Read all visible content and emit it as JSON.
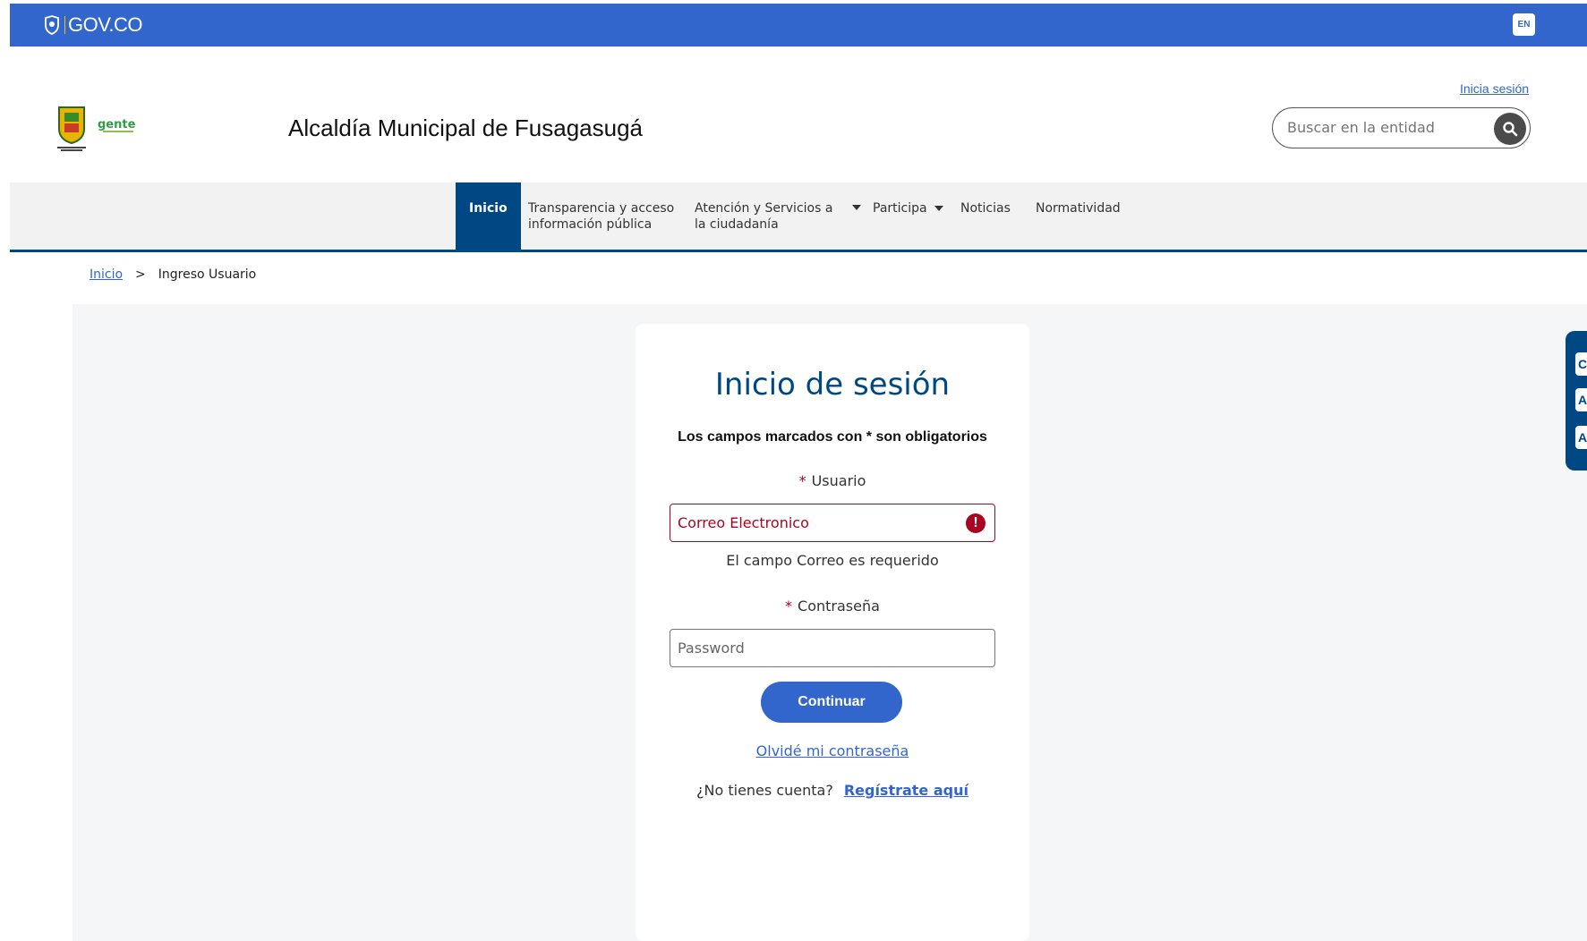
{
  "govbar": {
    "brand": "GOV.CO",
    "lang": "EN"
  },
  "header": {
    "title": "Alcaldía Municipal de Fusagasugá",
    "login_link": "Inicia sesión",
    "search_placeholder": "Buscar en la entidad"
  },
  "nav": {
    "items": [
      {
        "label": "Inicio"
      },
      {
        "label_line1": "Transparencia y acceso",
        "label_line2": "información pública"
      },
      {
        "label_line1": "Atención y Servicios a",
        "label_line2": "la ciudadanía"
      },
      {
        "label": "Participa"
      },
      {
        "label": "Noticias"
      },
      {
        "label": "Normatividad"
      }
    ]
  },
  "breadcrumb": {
    "home": "Inicio",
    "separator": ">",
    "current": "Ingreso Usuario"
  },
  "login": {
    "title": "Inicio de sesión",
    "required_note": "Los campos marcados con * son obligatorios",
    "user_label": "Usuario",
    "user_value": "Correo Electronico",
    "user_error": "El campo Correo es requerido",
    "password_label": "Contraseña",
    "password_placeholder": "Password",
    "submit_label": "Continuar",
    "forgot_label": "Olvidé mi contraseña",
    "no_account_text": "¿No tienes cuenta?",
    "register_label": "Regístrate aquí",
    "required_mark": "*"
  },
  "a11y": {
    "buttons": [
      "C",
      "A",
      "A"
    ]
  },
  "colors": {
    "gov_blue": "#3366cc",
    "navy": "#004884",
    "error": "#a80521"
  }
}
